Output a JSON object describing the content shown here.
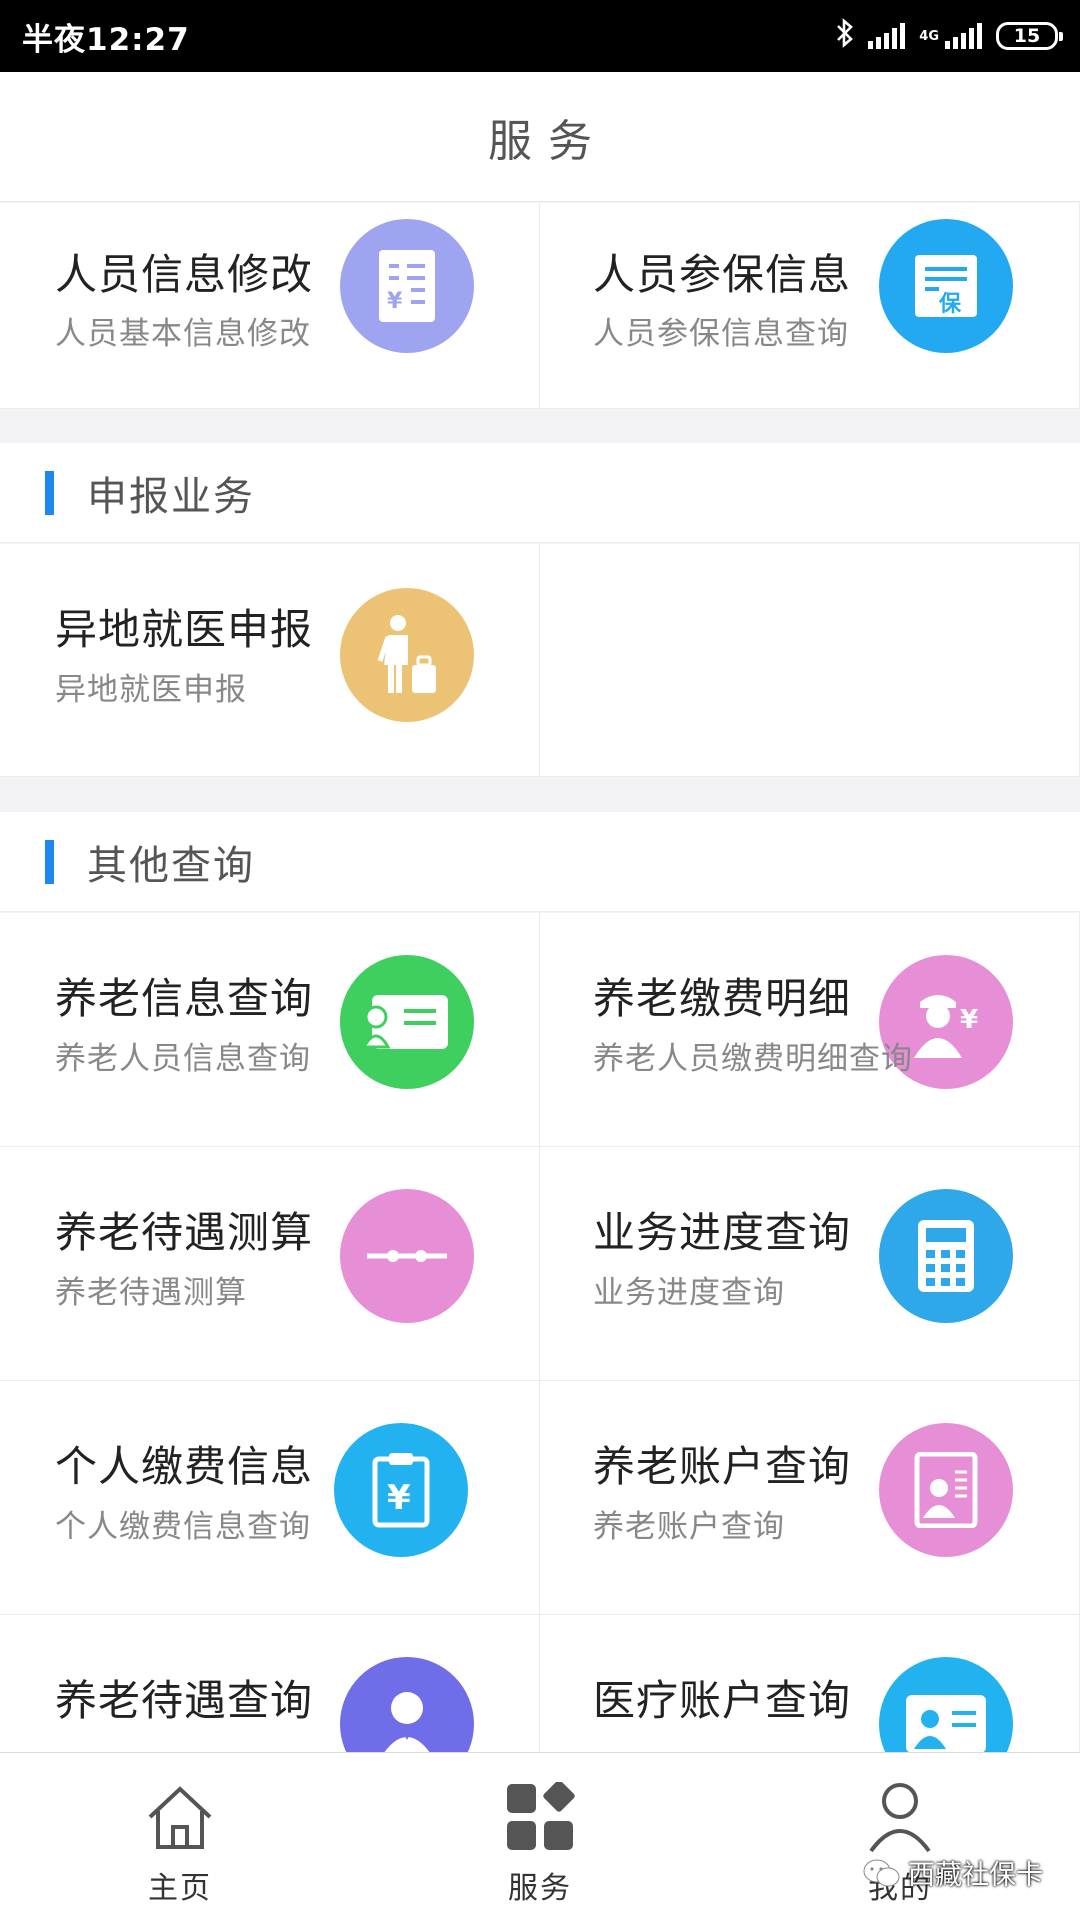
{
  "status_bar": {
    "time": "半夜12:27",
    "network": "4G",
    "battery": "15"
  },
  "header": {
    "title": "服务"
  },
  "top_cards": [
    {
      "name": "人员信息修改",
      "desc": "人员基本信息修改",
      "icon": "document-yen-icon",
      "color": "#9ea4f0"
    },
    {
      "name": "人员参保信息",
      "desc": "人员参保信息查询",
      "icon": "insurance-doc-icon",
      "color": "#22a9f2"
    }
  ],
  "sections": {
    "declare": {
      "title": "申报业务",
      "cards": [
        {
          "name": "异地就医申报",
          "desc": "异地就医申报",
          "icon": "traveler-luggage-icon",
          "color": "#ecc274"
        }
      ]
    },
    "other": {
      "title": "其他查询",
      "cards": [
        {
          "name": "养老信息查询",
          "desc": "养老人员信息查询",
          "icon": "id-card-icon",
          "color": "#3fcf5e"
        },
        {
          "name": "养老缴费明细",
          "desc": "养老人员缴费明细查询",
          "icon": "person-yen-icon",
          "color": "#e68fd6"
        },
        {
          "name": "养老待遇测算",
          "desc": "养老待遇测算",
          "icon": "slider-icon",
          "color": "#e68fd6"
        },
        {
          "name": "业务进度查询",
          "desc": "业务进度查询",
          "icon": "calculator-icon",
          "color": "#2ea8e8"
        },
        {
          "name": "个人缴费信息",
          "desc": "个人缴费信息查询",
          "icon": "clipboard-yen-icon",
          "color": "#22b2f0"
        },
        {
          "name": "养老账户查询",
          "desc": "养老账户查询",
          "icon": "profile-doc-icon",
          "color": "#e68fd6"
        },
        {
          "name": "养老待遇查询",
          "desc": "",
          "icon": "person-tie-icon",
          "color": "#6f6ee8"
        },
        {
          "name": "医疗账户查询",
          "desc": "",
          "icon": "badge-card-icon",
          "color": "#22b2f0"
        }
      ]
    }
  },
  "tabbar": [
    {
      "label": "主页",
      "icon": "home-icon"
    },
    {
      "label": "服务",
      "icon": "grid-icon"
    },
    {
      "label": "我的",
      "icon": "user-icon"
    }
  ],
  "watermark": "西藏社保卡"
}
